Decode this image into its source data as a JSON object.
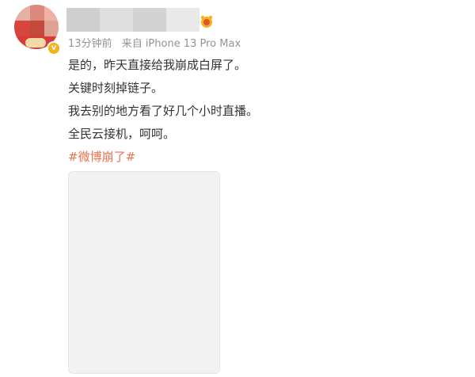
{
  "post": {
    "timestamp": "13分钟前",
    "source": "来自 iPhone 13 Pro Max",
    "lines": [
      "是的，昨天直接给我崩成白屏了。",
      "关键时刻掉链子。",
      "我去别的地方看了好几个小时直播。",
      "全民云接机，呵呵。"
    ],
    "hashtag": "#微博崩了#"
  },
  "icons": {
    "verified": "verified-badge-icon",
    "vip": "vip-crown-icon"
  },
  "colors": {
    "hashtag": "#eb7350",
    "meta_text": "#939393",
    "body_text": "#333333",
    "verified": "#f6b21a"
  }
}
